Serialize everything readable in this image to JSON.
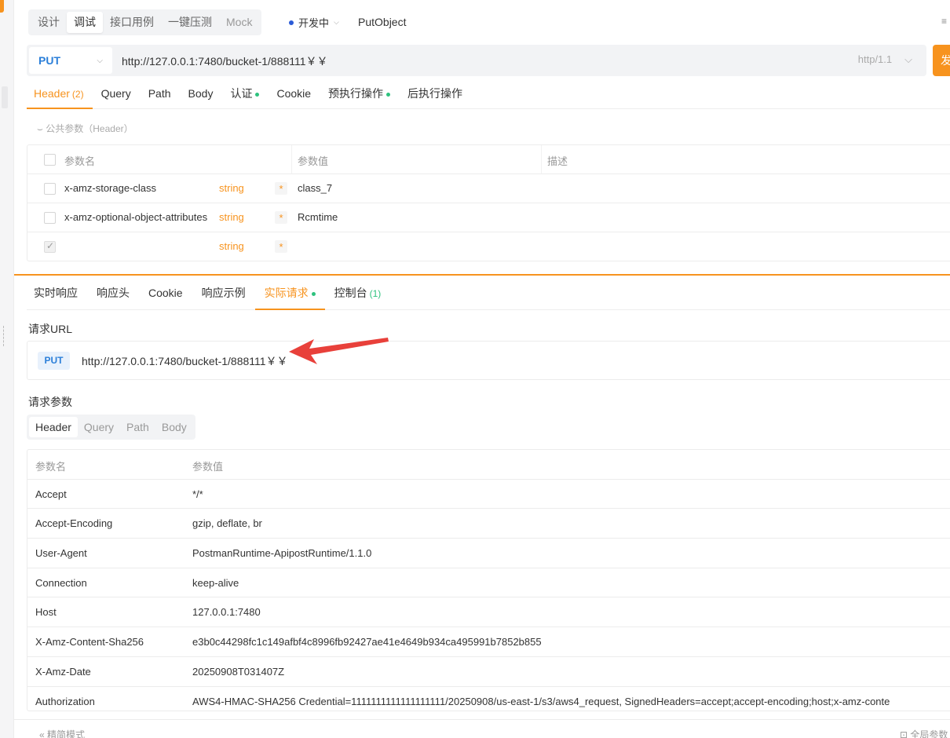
{
  "mode_tabs": [
    "设计",
    "调试",
    "接口用例",
    "一键压测",
    "Mock"
  ],
  "environment": "开发中",
  "api_name": "PutObject",
  "request": {
    "method": "PUT",
    "url": "http://127.0.0.1:7480/bucket-1/888111￥￥",
    "http_version": "http/1.1",
    "send_label": "发"
  },
  "request_tabs": {
    "header": "Header",
    "header_count": "(2)",
    "query": "Query",
    "path": "Path",
    "body": "Body",
    "auth": "认证",
    "cookie": "Cookie",
    "pre": "预执行操作",
    "post": "后执行操作"
  },
  "public_params": "公共参数（Header）",
  "header_table": {
    "col_name": "参数名",
    "col_value": "参数值",
    "col_desc": "描述",
    "rows": [
      {
        "name": "x-amz-storage-class",
        "type": "string",
        "value": "class_7"
      },
      {
        "name": "x-amz-optional-object-attributes",
        "type": "string",
        "value": "Rcmtime"
      },
      {
        "name": "",
        "type": "string",
        "value": ""
      }
    ]
  },
  "response_tabs": {
    "realtime": "实时响应",
    "headers": "响应头",
    "cookie": "Cookie",
    "example": "响应示例",
    "actual": "实际请求",
    "console": "控制台",
    "console_count": "(1)"
  },
  "actual_request": {
    "url_title": "请求URL",
    "method": "PUT",
    "url": "http://127.0.0.1:7480/bucket-1/888111￥￥",
    "params_title": "请求参数",
    "sub_tabs": [
      "Header",
      "Query",
      "Path",
      "Body"
    ],
    "table": {
      "col_name": "参数名",
      "col_value": "参数值",
      "rows": [
        {
          "k": "Accept",
          "v": "*/*"
        },
        {
          "k": "Accept-Encoding",
          "v": "gzip, deflate, br"
        },
        {
          "k": "User-Agent",
          "v": "PostmanRuntime-ApipostRuntime/1.1.0"
        },
        {
          "k": "Connection",
          "v": "keep-alive"
        },
        {
          "k": "Host",
          "v": "127.0.0.1:7480"
        },
        {
          "k": "X-Amz-Content-Sha256",
          "v": "e3b0c44298fc1c149afbf4c8996fb92427ae41e4649b934ca495991b7852b855"
        },
        {
          "k": "X-Amz-Date",
          "v": "20250908T031407Z"
        },
        {
          "k": "Authorization",
          "v": "AWS4-HMAC-SHA256 Credential=1111111111111111111/20250908/us-east-1/s3/aws4_request, SignedHeaders=accept;accept-encoding;host;x-amz-conte"
        }
      ]
    }
  },
  "footer": {
    "left": "精简模式",
    "right": "全局参数"
  },
  "colors": {
    "accent": "#f7931e",
    "method": "#2b7fd9",
    "dot": "#2ec27e",
    "arrow": "#e8403a"
  }
}
